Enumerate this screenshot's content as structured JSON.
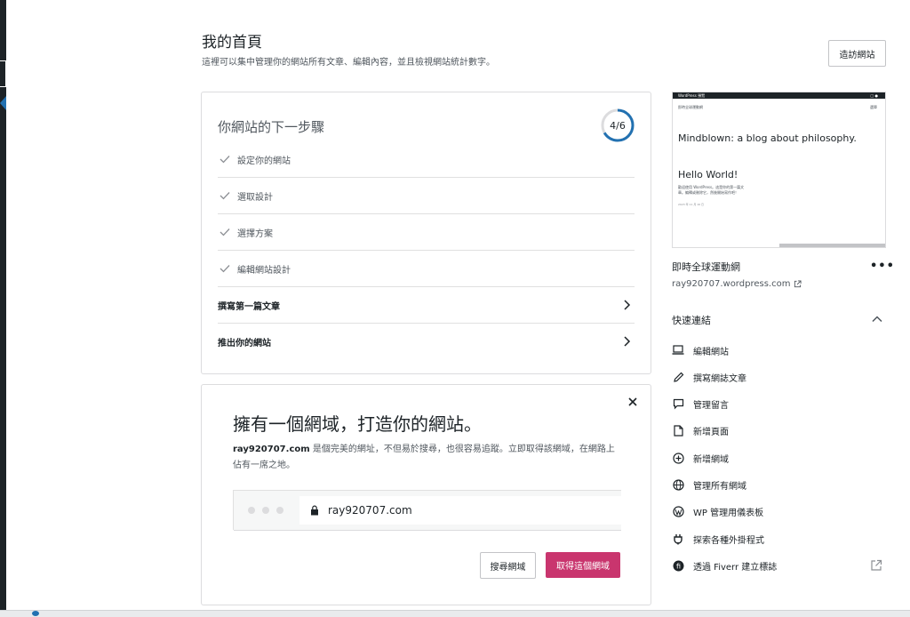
{
  "header": {
    "title": "我的首頁",
    "subtitle": "這裡可以集中管理你的網站所有文章、編輯內容，並且檢視網站統計數字。",
    "visit_site": "造訪網站"
  },
  "steps_card": {
    "title": "你網站的下一步驟",
    "progress_label": "4/6",
    "progress_fraction": 0.667,
    "progress_color": "#2271b1",
    "items": [
      {
        "label": "設定你的網站",
        "done": true
      },
      {
        "label": "選取設計",
        "done": true
      },
      {
        "label": "選擇方案",
        "done": true
      },
      {
        "label": "編輯網站設計",
        "done": true
      },
      {
        "label": "撰寫第一篇文章",
        "done": false
      },
      {
        "label": "推出你的網站",
        "done": false
      }
    ]
  },
  "domain_card": {
    "heading": "擁有一個網域，打造你的網站。",
    "desc_domain": "ray920707.com",
    "desc_rest": " 是個完美的網址，不但易於搜尋，也很容易追蹤。立即取得該網域，在網路上佔有一席之地。",
    "url": "ray920707.com",
    "search_button": "搜尋網域",
    "get_button": "取得這個網域",
    "accent_color": "#c9356e"
  },
  "site_preview": {
    "topbar_left": "WordPress  預覽",
    "topbar_right": "□  ●",
    "small_header": "即時全球運動網",
    "small_header_right": "選單",
    "blog_title": "Mindblown: a blog about philosophy.",
    "post_title": "Hello World!",
    "post_body": "歡迎使用 WordPress。這是你的第一篇文章。編輯或刪除它，然後開始寫作吧！",
    "post_meta": "2023 年 11 月 16 日"
  },
  "site_info": {
    "name": "即時全球運動網",
    "url": "ray920707.wordpress.com",
    "more_label": "•••"
  },
  "quick_links": {
    "title": "快速連結",
    "items": [
      {
        "label": "編輯網站",
        "icon": "laptop-icon"
      },
      {
        "label": "撰寫網誌文章",
        "icon": "pencil-icon"
      },
      {
        "label": "管理留言",
        "icon": "comment-icon"
      },
      {
        "label": "新增頁面",
        "icon": "page-icon"
      },
      {
        "label": "新增網域",
        "icon": "plus-circle-icon"
      },
      {
        "label": "管理所有網域",
        "icon": "globe-icon"
      },
      {
        "label": "WP 管理用儀表板",
        "icon": "wordpress-icon"
      },
      {
        "label": "探索各種外掛程式",
        "icon": "plugin-icon"
      },
      {
        "label": "透過 Fiverr 建立標誌",
        "icon": "fiverr-icon"
      }
    ]
  }
}
